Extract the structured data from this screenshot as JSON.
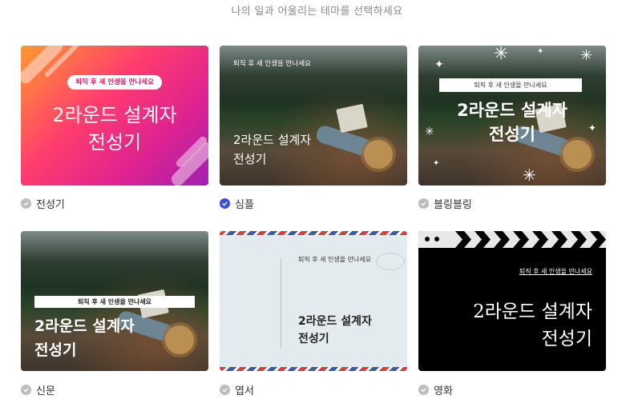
{
  "subtitle": "나의 일과 어울리는 테마를 선택하세요",
  "colors": {
    "selected": "#3b4fd8",
    "unselected": "#bdbdbd"
  },
  "themes": [
    {
      "name": "전성기",
      "selected": false,
      "tagline": "퇴직 후 새 인생을 만나세요",
      "title_line1": "2라운드 설계자",
      "title_line2": "전성기"
    },
    {
      "name": "심플",
      "selected": true,
      "tagline": "퇴직 후 새 인생을 만나세요",
      "title_line1": "2라운드 설계자",
      "title_line2": "전성기"
    },
    {
      "name": "블링블링",
      "selected": false,
      "tagline": "퇴직 후 새 인생을 만나세요",
      "title_line1": "2라운드 설계자",
      "title_line2": "전성기"
    },
    {
      "name": "신문",
      "selected": false,
      "tagline": "퇴직 후 새 인생을 만나세요",
      "title_line1": "2라운드 설계자",
      "title_line2": "전성기"
    },
    {
      "name": "엽서",
      "selected": false,
      "tagline": "퇴직 후 새 인생을 만나세요",
      "title_line1": "2라운드 설계자",
      "title_line2": "전성기"
    },
    {
      "name": "영화",
      "selected": false,
      "tagline": "퇴직 후 새 인생을 만나세요",
      "title_line1": "2라운드 설계자",
      "title_line2": "전성기"
    }
  ]
}
